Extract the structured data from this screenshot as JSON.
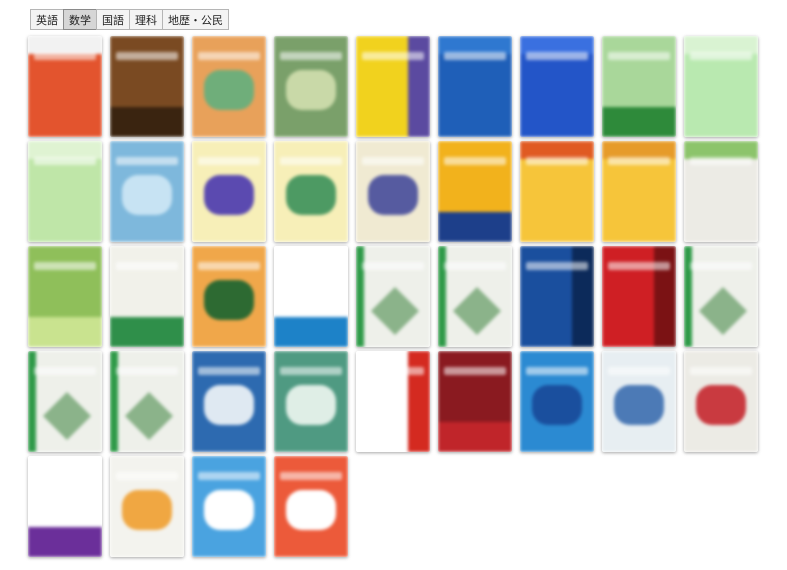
{
  "tabs": [
    {
      "label": "英語",
      "active": false
    },
    {
      "label": "数学",
      "active": true
    },
    {
      "label": "国語",
      "active": false
    },
    {
      "label": "理科",
      "active": false
    },
    {
      "label": "地歴・公民",
      "active": false
    }
  ],
  "books": [
    {
      "bg": "#e3542e",
      "accent": "#f2f2f2",
      "motif": "top"
    },
    {
      "bg": "#7a4a22",
      "accent": "#3a2410",
      "motif": "bottom"
    },
    {
      "bg": "#e8a15a",
      "accent": "#6fae7a",
      "motif": "center"
    },
    {
      "bg": "#7aa06a",
      "accent": "#c9d9a8",
      "motif": "center"
    },
    {
      "bg": "#f1d21e",
      "accent": "#5b4aa0",
      "motif": "side"
    },
    {
      "bg": "#1f5fb8",
      "accent": "#2f78d0",
      "motif": "top"
    },
    {
      "bg": "#2355c8",
      "accent": "#3a70e0",
      "motif": "top"
    },
    {
      "bg": "#a9d79a",
      "accent": "#2e8a3a",
      "motif": "bottom"
    },
    {
      "bg": "#b9e9b0",
      "accent": "#d9f3d2",
      "motif": "top"
    },
    {
      "bg": "#bfe6a8",
      "accent": "#dff3d2",
      "motif": "top"
    },
    {
      "bg": "#7eb8dc",
      "accent": "#c7e3f3",
      "motif": "center"
    },
    {
      "bg": "#f7efb8",
      "accent": "#5b4ab0",
      "motif": "center"
    },
    {
      "bg": "#f7efb8",
      "accent": "#4d9a63",
      "motif": "center"
    },
    {
      "bg": "#f0ead2",
      "accent": "#565ba0",
      "motif": "center"
    },
    {
      "bg": "#f2b21c",
      "accent": "#1d3f8a",
      "motif": "bottom"
    },
    {
      "bg": "#f6c53a",
      "accent": "#e05a22",
      "motif": "top"
    },
    {
      "bg": "#f6c53a",
      "accent": "#e69b2a",
      "motif": "top"
    },
    {
      "bg": "#ecebe5",
      "accent": "#8cc46b",
      "motif": "top"
    },
    {
      "bg": "#8fbf5a",
      "accent": "#c9e38f",
      "motif": "bottom"
    },
    {
      "bg": "#f1f1ea",
      "accent": "#2f8f4a",
      "motif": "bottom"
    },
    {
      "bg": "#f0a74a",
      "accent": "#2d6a32",
      "motif": "center"
    },
    {
      "bg": "#ffffff",
      "accent": "#1d82c8",
      "motif": "bottom"
    },
    {
      "bg": "#eef0ea",
      "accent": "#2e9a48",
      "motif": "diamond"
    },
    {
      "bg": "#eef0ea",
      "accent": "#2e9a48",
      "motif": "diamond"
    },
    {
      "bg": "#1a4f9e",
      "accent": "#0c2a5a",
      "motif": "side"
    },
    {
      "bg": "#cf1f24",
      "accent": "#7b1214",
      "motif": "side"
    },
    {
      "bg": "#eef0ea",
      "accent": "#2e9a48",
      "motif": "diamond"
    },
    {
      "bg": "#eef0ea",
      "accent": "#2e9a48",
      "motif": "diamond"
    },
    {
      "bg": "#eef0ea",
      "accent": "#2e9a48",
      "motif": "diamond"
    },
    {
      "bg": "#2d6ab0",
      "accent": "#dfe9f2",
      "motif": "center"
    },
    {
      "bg": "#4f9a82",
      "accent": "#dfeee6",
      "motif": "center"
    },
    {
      "bg": "#ffffff",
      "accent": "#d42a20",
      "motif": "side"
    },
    {
      "bg": "#8a1a20",
      "accent": "#c0252a",
      "motif": "bottom"
    },
    {
      "bg": "#2b8ad2",
      "accent": "#1a4f9e",
      "motif": "center"
    },
    {
      "bg": "#e7eef2",
      "accent": "#4c7ab6",
      "motif": "center"
    },
    {
      "bg": "#ecebe5",
      "accent": "#c93a40",
      "motif": "center"
    },
    {
      "bg": "#ffffff",
      "accent": "#6b2f9a",
      "motif": "bottom"
    },
    {
      "bg": "#f3f3ee",
      "accent": "#f0a742",
      "motif": "center"
    },
    {
      "bg": "#4aa3e0",
      "accent": "#ffffff",
      "motif": "center"
    },
    {
      "bg": "#ec5a3a",
      "accent": "#ffffff",
      "motif": "center"
    }
  ]
}
